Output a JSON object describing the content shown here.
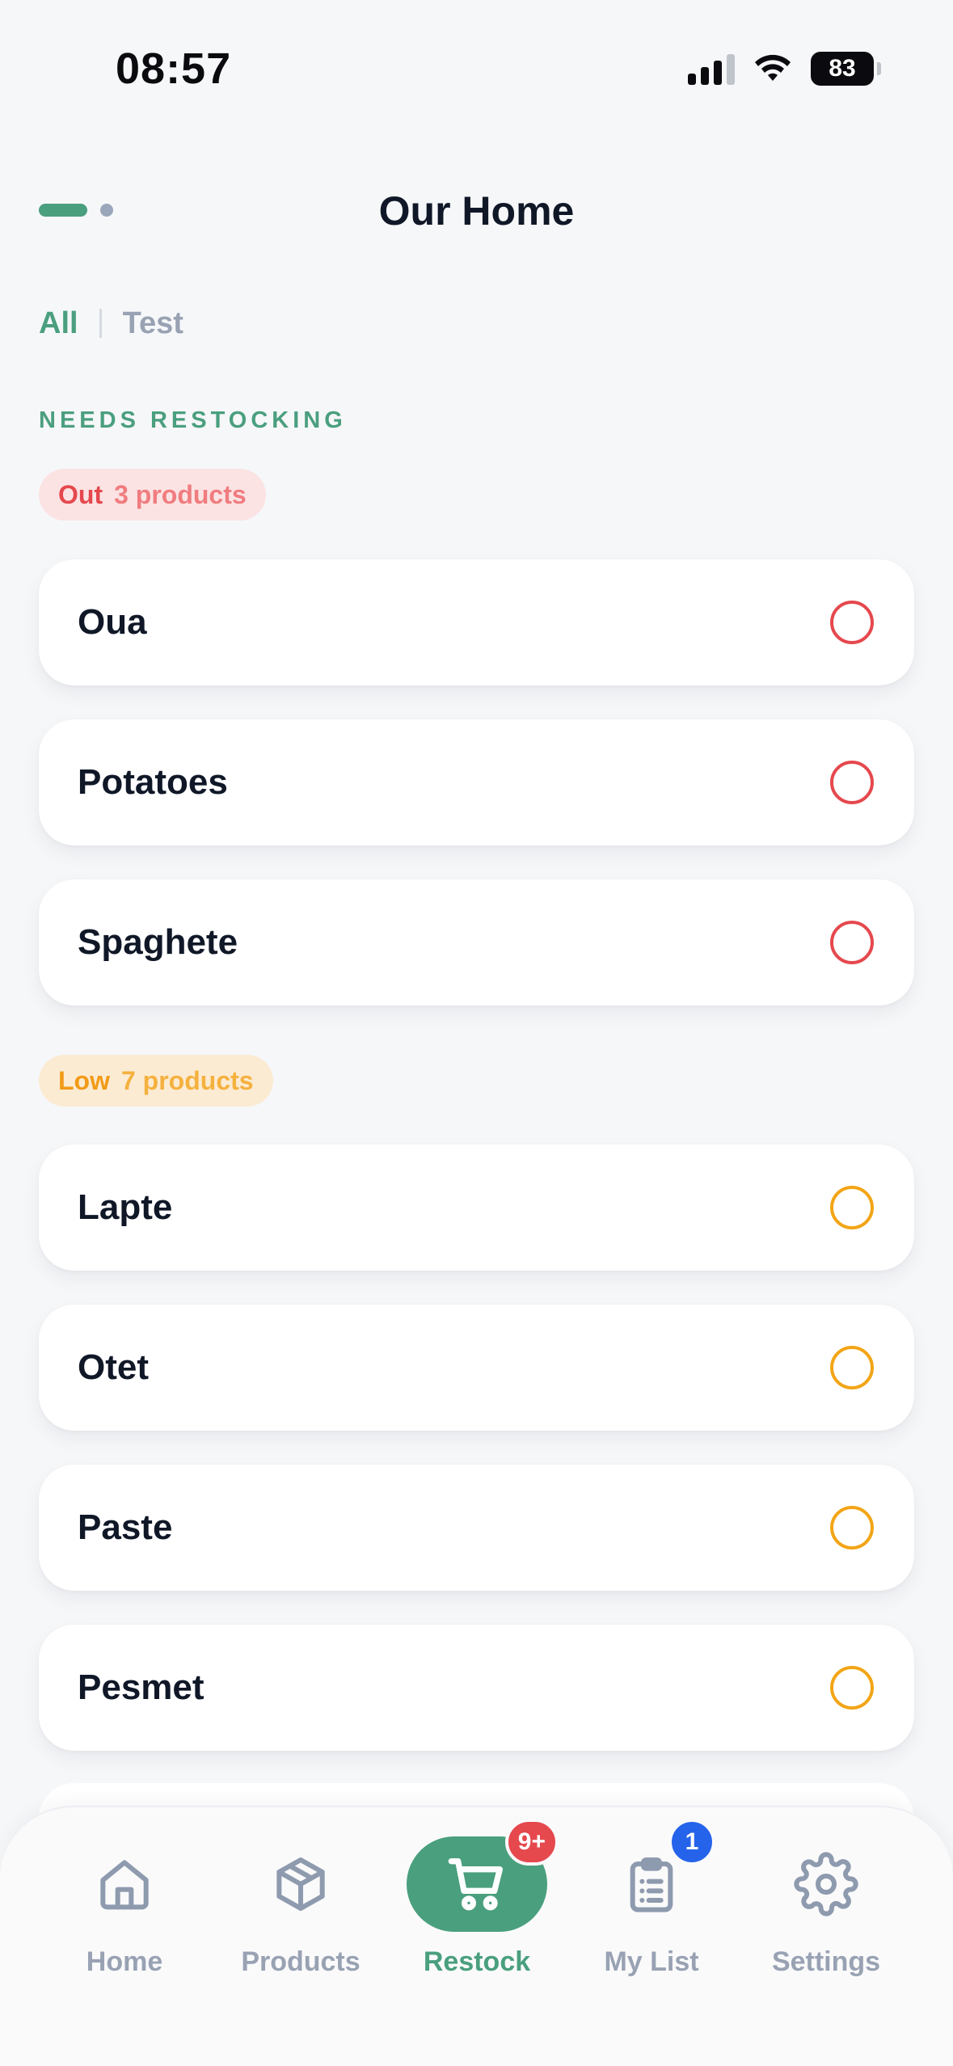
{
  "status_bar": {
    "time": "08:57",
    "battery": "83"
  },
  "header": {
    "title": "Our Home"
  },
  "filters": [
    {
      "label": "All",
      "active": true
    },
    {
      "label": "Test",
      "active": false
    }
  ],
  "section": {
    "label": "NEEDS RESTOCKING"
  },
  "groups": {
    "out": {
      "label": "Out",
      "count": "3 products",
      "color": "#E5484D"
    },
    "low": {
      "label": "Low",
      "count": "7 products",
      "color": "#F2A516"
    }
  },
  "products": {
    "out": [
      "Oua",
      "Potatoes",
      "Spaghete"
    ],
    "low": [
      "Lapte",
      "Otet",
      "Paste",
      "Pesmet"
    ]
  },
  "tab_bar": {
    "items": [
      {
        "label": "Home",
        "icon": "home-icon",
        "active": false
      },
      {
        "label": "Products",
        "icon": "package-icon",
        "active": false
      },
      {
        "label": "Restock",
        "icon": "cart-icon",
        "active": true,
        "badge": "9+"
      },
      {
        "label": "My List",
        "icon": "clipboard-list-icon",
        "active": false,
        "badge": "1"
      },
      {
        "label": "Settings",
        "icon": "gear-icon",
        "active": false
      }
    ]
  },
  "colors": {
    "accent": "#4A9F7E",
    "out": "#E5484D",
    "low": "#F2A516",
    "badge_blue": "#2563EB"
  }
}
